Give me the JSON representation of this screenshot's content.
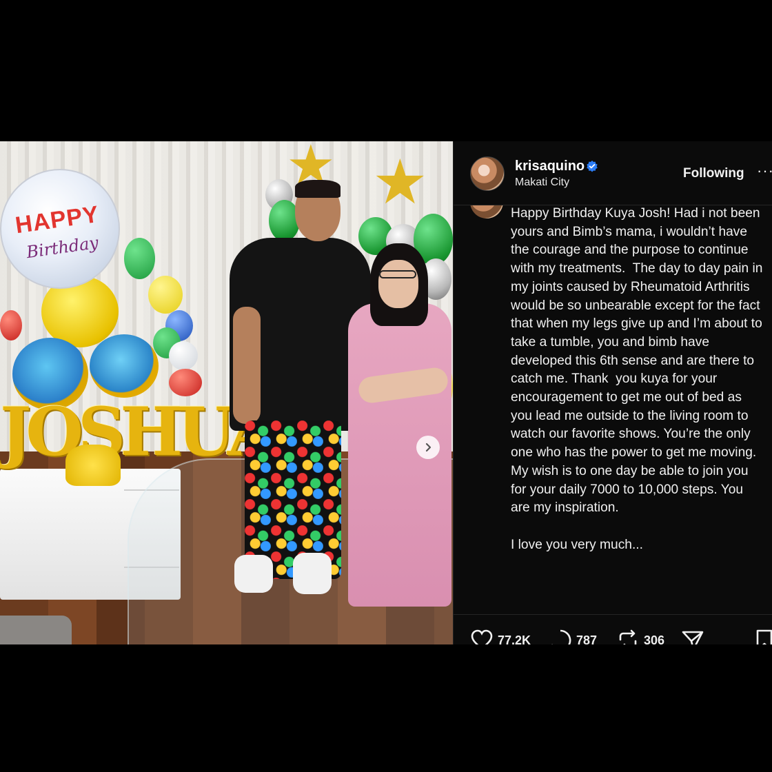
{
  "post": {
    "username": "krisaquino",
    "location": "Makati City",
    "follow_label": "Following",
    "more_label": "···",
    "caption": "Happy Birthday Kuya Josh! Had i not been yours and Bimb’s mama, i wouldn’t have the courage and the purpose to continue with my treatments.  The day to day pain in my joints caused by Rheumatoid Arthritis would be so unbearable except for the fact that when my legs give up and I’m about to take a tumble, you and bimb have developed this 6th sense and are there to catch me. Thank  you kuya for your encouragement to get me out of bed as you lead me outside to the living room to watch our favorite shows. You’re the only one who has the power to get me moving. My wish is to one day be able to join you for your daily 7000 to 10,000 steps. You are my inspiration.\n\nI love you very much..."
  },
  "photo": {
    "balloon_text_happy": "HAPPY",
    "balloon_text_birthday": "Birthday",
    "balloon_letters": "JOSHUA"
  },
  "actions": {
    "likes": "77.2K",
    "comments": "787",
    "reposts": "306"
  },
  "icons": {
    "verified": "verified-badge-icon",
    "next": "chevron-right-icon",
    "like": "heart-icon",
    "comment": "comment-bubble-icon",
    "repost": "repost-icon",
    "share": "send-icon",
    "save": "bookmark-icon"
  },
  "colors": {
    "background": "#000000",
    "sidebar": "#0b0b0b",
    "verified_blue": "#2b7cf5",
    "text": "#f0f0f0"
  }
}
